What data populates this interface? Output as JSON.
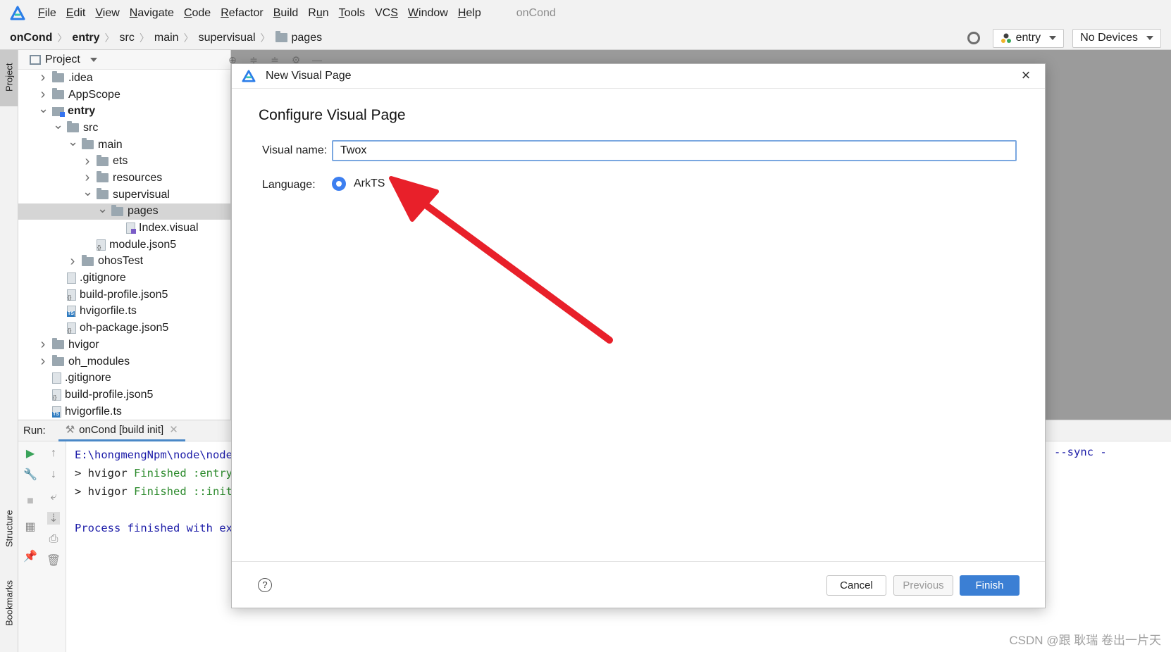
{
  "menubar": {
    "items": [
      {
        "label": "File",
        "u": "F"
      },
      {
        "label": "Edit",
        "u": "E"
      },
      {
        "label": "View",
        "u": "V"
      },
      {
        "label": "Navigate",
        "u": "N"
      },
      {
        "label": "Code",
        "u": "C"
      },
      {
        "label": "Refactor",
        "u": "R"
      },
      {
        "label": "Build",
        "u": "B"
      },
      {
        "label": "Run",
        "u": "u"
      },
      {
        "label": "Tools",
        "u": "T"
      },
      {
        "label": "VCS",
        "u": "S"
      },
      {
        "label": "Window",
        "u": "W"
      },
      {
        "label": "Help",
        "u": "H"
      }
    ],
    "project_title": "onCond"
  },
  "breadcrumb": {
    "items": [
      "onCond",
      "entry",
      "src",
      "main",
      "supervisual",
      "pages"
    ]
  },
  "toolbar": {
    "module_combo": "entry",
    "device_combo": "No Devices"
  },
  "left_strip": {
    "project_tab": "Project",
    "structure_tab": "Structure",
    "bookmarks_tab": "Bookmarks"
  },
  "project_panel": {
    "title": "Project",
    "tree": [
      {
        "label": ".idea",
        "indent": 0,
        "chev": "right",
        "icon": "folder"
      },
      {
        "label": "AppScope",
        "indent": 0,
        "chev": "right",
        "icon": "folder"
      },
      {
        "label": "entry",
        "indent": 0,
        "chev": "down",
        "icon": "folder-module",
        "bold": true
      },
      {
        "label": "src",
        "indent": 1,
        "chev": "down",
        "icon": "folder"
      },
      {
        "label": "main",
        "indent": 2,
        "chev": "down",
        "icon": "folder"
      },
      {
        "label": "ets",
        "indent": 3,
        "chev": "right",
        "icon": "folder"
      },
      {
        "label": "resources",
        "indent": 3,
        "chev": "right",
        "icon": "folder"
      },
      {
        "label": "supervisual",
        "indent": 3,
        "chev": "down",
        "icon": "folder"
      },
      {
        "label": "pages",
        "indent": 4,
        "chev": "down",
        "icon": "folder",
        "selected": true
      },
      {
        "label": "Index.visual",
        "indent": 5,
        "chev": "none",
        "icon": "file-visual"
      },
      {
        "label": "module.json5",
        "indent": 3,
        "chev": "none",
        "icon": "file-json"
      },
      {
        "label": "ohosTest",
        "indent": 2,
        "chev": "right",
        "icon": "folder"
      },
      {
        "label": ".gitignore",
        "indent": 1,
        "chev": "none",
        "icon": "file"
      },
      {
        "label": "build-profile.json5",
        "indent": 1,
        "chev": "none",
        "icon": "file-json"
      },
      {
        "label": "hvigorfile.ts",
        "indent": 1,
        "chev": "none",
        "icon": "file-ts"
      },
      {
        "label": "oh-package.json5",
        "indent": 1,
        "chev": "none",
        "icon": "file-json"
      },
      {
        "label": "hvigor",
        "indent": 0,
        "chev": "right",
        "icon": "folder"
      },
      {
        "label": "oh_modules",
        "indent": 0,
        "chev": "right",
        "icon": "folder"
      },
      {
        "label": ".gitignore",
        "indent": 0,
        "chev": "none",
        "icon": "file"
      },
      {
        "label": "build-profile.json5",
        "indent": 0,
        "chev": "none",
        "icon": "file-json"
      },
      {
        "label": "hvigorfile.ts",
        "indent": 0,
        "chev": "none",
        "icon": "file-ts"
      }
    ]
  },
  "run_panel": {
    "label": "Run:",
    "tab_label": "onCond [build init]",
    "lines": [
      {
        "parts": [
          {
            "t": "E:\\hongmengNpm\\node\\node",
            "c": "c-path"
          }
        ]
      },
      {
        "parts": [
          {
            "t": "> hvigor ",
            "c": ""
          },
          {
            "t": "Finished :entry",
            "c": "c-green"
          }
        ]
      },
      {
        "parts": [
          {
            "t": "> hvigor ",
            "c": ""
          },
          {
            "t": "Finished ::init",
            "c": "c-green"
          }
        ]
      },
      {
        "parts": [
          {
            "t": "",
            "c": ""
          }
        ]
      },
      {
        "parts": [
          {
            "t": "Process finished with ex",
            "c": "c-blue"
          }
        ]
      }
    ],
    "right_text": "--sync -"
  },
  "dialog": {
    "title": "New Visual Page",
    "heading": "Configure Visual Page",
    "name_label": "Visual name:",
    "name_value": "Twox",
    "language_label": "Language:",
    "language_option": "ArkTS",
    "cancel": "Cancel",
    "previous": "Previous",
    "finish": "Finish",
    "help": "?"
  },
  "colors": {
    "accent": "#3b7fd4",
    "arrow": "#e8202a",
    "selected_row": "#d5d5d5"
  },
  "watermark": "CSDN @跟 耿瑞 卷出一片天"
}
